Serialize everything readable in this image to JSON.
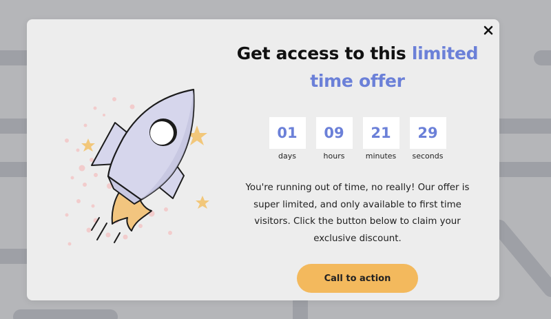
{
  "modal": {
    "headline_part1": "Get access to this ",
    "headline_accent": "limited time offer",
    "countdown": [
      {
        "value": "01",
        "label": "days"
      },
      {
        "value": "09",
        "label": "hours"
      },
      {
        "value": "21",
        "label": "minutes"
      },
      {
        "value": "29",
        "label": "seconds"
      }
    ],
    "body": "You're running out of time, no really! Our offer is super limited, and only available to first time visitors. Click the button below to claim your exclusive discount.",
    "cta_label": "Call to action",
    "close_icon": "close-icon"
  },
  "colors": {
    "accent": "#6b80d8",
    "cta": "#f3b95d",
    "modal_bg": "#ededed",
    "page_bg": "#b5b6b9"
  }
}
